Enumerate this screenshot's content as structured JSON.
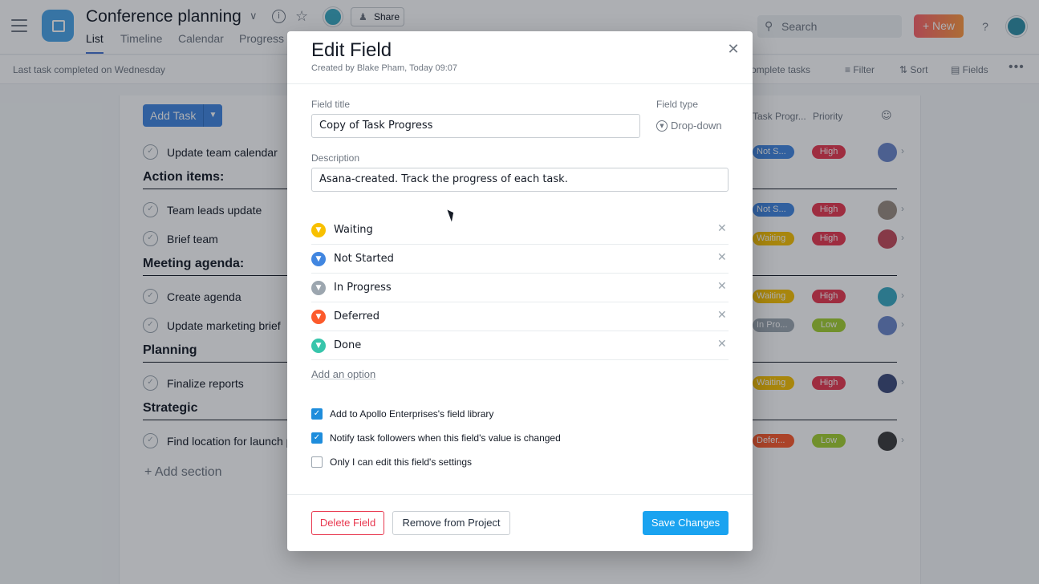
{
  "app": {
    "project_title": "Conference planning",
    "share_label": "Share",
    "tabs": [
      "List",
      "Timeline",
      "Calendar",
      "Progress"
    ],
    "search_placeholder": "Search",
    "new_label": "+ New",
    "help_label": "?"
  },
  "subbar": {
    "status": "Last task completed on Wednesday",
    "incomplete": "Incomplete tasks",
    "filter": "Filter",
    "sort": "Sort",
    "fields": "Fields",
    "more": "•••"
  },
  "list": {
    "add_task": "Add Task",
    "columns": {
      "task_progress": "Task Progr...",
      "priority": "Priority"
    },
    "sections": [
      "Action items:",
      "Meeting agenda:",
      "Planning",
      "Strategic"
    ],
    "tasks": [
      {
        "name": "Update team calendar",
        "status": "Not S...",
        "priority": "High"
      },
      {
        "name": "Team leads update",
        "status": "Not S...",
        "priority": "High"
      },
      {
        "name": "Brief team",
        "status": "Waiting",
        "priority": "High"
      },
      {
        "name": "Create agenda",
        "status": "Waiting",
        "priority": "High"
      },
      {
        "name": "Update marketing brief",
        "status": "In Pro...",
        "priority": "Low"
      },
      {
        "name": "Finalize reports",
        "status": "Waiting",
        "priority": "High"
      },
      {
        "name": "Find location for launch p",
        "status": "Defer...",
        "priority": "Low"
      }
    ],
    "add_section": "+ Add section"
  },
  "modal": {
    "title": "Edit Field",
    "subtitle": "Created by Blake Pham, Today 09:07",
    "field_title_label": "Field title",
    "field_title_value": "Copy of Task Progress",
    "field_type_label": "Field type",
    "field_type_value": "Drop-down",
    "description_label": "Description",
    "description_value": "Asana-created. Track the progress of each task.",
    "options": [
      {
        "label": "Waiting",
        "color": "#f8c000"
      },
      {
        "label": "Not Started",
        "color": "#4186e0"
      },
      {
        "label": "In Progress",
        "color": "#9ca6af"
      },
      {
        "label": "Deferred",
        "color": "#fc5a2b"
      },
      {
        "label": "Done",
        "color": "#37c5ab"
      }
    ],
    "add_option": "Add an option",
    "checkboxes": [
      {
        "label": "Add to Apollo Enterprises's field library",
        "checked": true
      },
      {
        "label": "Notify task followers when this field's value is changed",
        "checked": true
      },
      {
        "label": "Only I can edit this field's settings",
        "checked": false
      }
    ],
    "delete_label": "Delete Field",
    "remove_label": "Remove from Project",
    "save_label": "Save Changes"
  }
}
